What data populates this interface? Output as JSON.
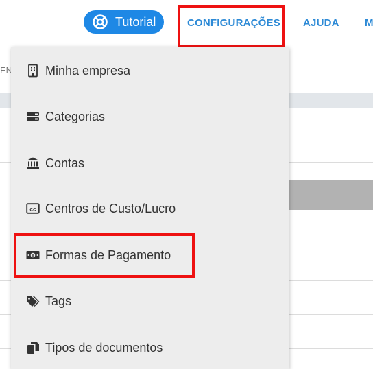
{
  "topnav": {
    "tutorial_label": "Tutorial",
    "configuracoes_label": "CONFIGURAÇÕES",
    "ajuda_label": "AJUDA",
    "more_label": "M"
  },
  "background": {
    "partial_text": "EN"
  },
  "menu": {
    "items": [
      {
        "label": "Minha empresa",
        "icon": "building-icon"
      },
      {
        "label": "Categorias",
        "icon": "list-icon"
      },
      {
        "label": "Contas",
        "icon": "bank-icon"
      },
      {
        "label": "Centros de Custo/Lucro",
        "icon": "cc-icon"
      },
      {
        "label": "Formas de Pagamento",
        "icon": "money-bill-icon"
      },
      {
        "label": "Tags",
        "icon": "tags-icon"
      },
      {
        "label": "Tipos de documentos",
        "icon": "copy-icon"
      }
    ]
  },
  "colors": {
    "accent": "#1e88e5",
    "nav_text": "#2d8ad6",
    "highlight": "#ee1111",
    "menu_bg": "#ededed"
  }
}
